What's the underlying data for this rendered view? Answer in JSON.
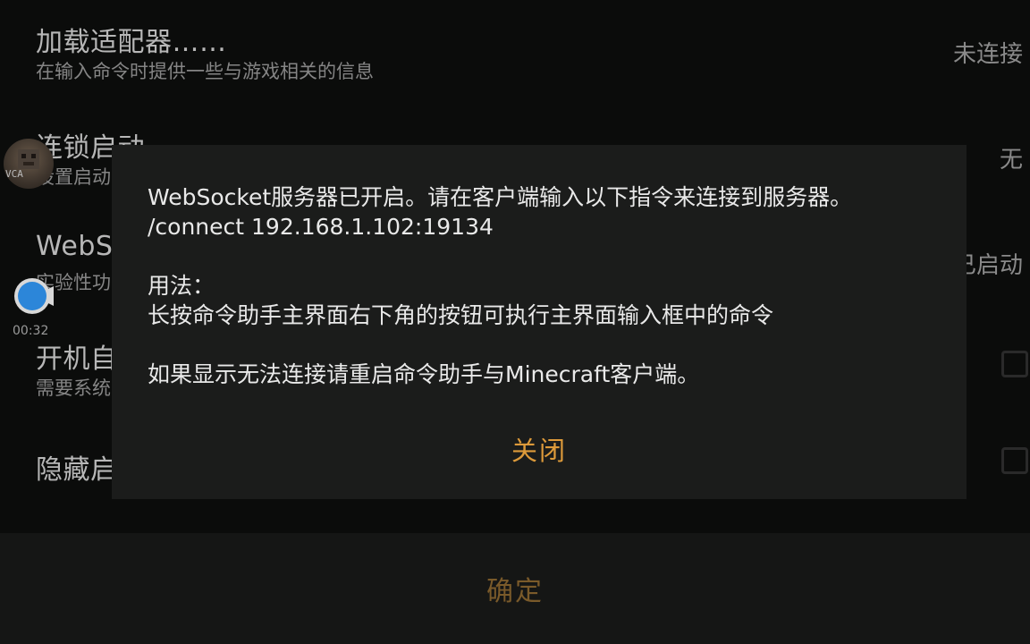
{
  "settings": {
    "rows": [
      {
        "title": "加载适配器……",
        "subtitle": "在输入命令时提供一些与游戏相关的信息",
        "value": "未连接"
      },
      {
        "title": "连锁启动",
        "subtitle": "设置启动",
        "value": "无"
      },
      {
        "title": "WebSocket",
        "subtitle": "实验性功能",
        "value": "已启动"
      },
      {
        "title": "开机自启",
        "subtitle": "需要系统",
        "value": ""
      },
      {
        "title": "隐藏启",
        "subtitle": "",
        "value": ""
      }
    ]
  },
  "avatar": {
    "label": "VCA"
  },
  "recorder": {
    "time": "00:32"
  },
  "dialog": {
    "lines": [
      "WebSocket服务器已开启。请在客户端输入以下指令来连接到服务器。",
      "/connect 192.168.1.102:19134",
      "",
      "用法：",
      "长按命令助手主界面右下角的按钮可执行主界面输入框中的命令",
      "",
      "如果显示无法连接请重启命令助手与Minecraft客户端。"
    ],
    "close_label": "关闭"
  },
  "bottom": {
    "confirm_label": "确定"
  },
  "colors": {
    "accent": "#dd9a3a",
    "dialog_bg": "#1b1c1b",
    "page_bg": "#0b0c0b"
  },
  "icons": [
    "avatar-icon",
    "screen-recorder-icon",
    "checkbox-icon"
  ]
}
